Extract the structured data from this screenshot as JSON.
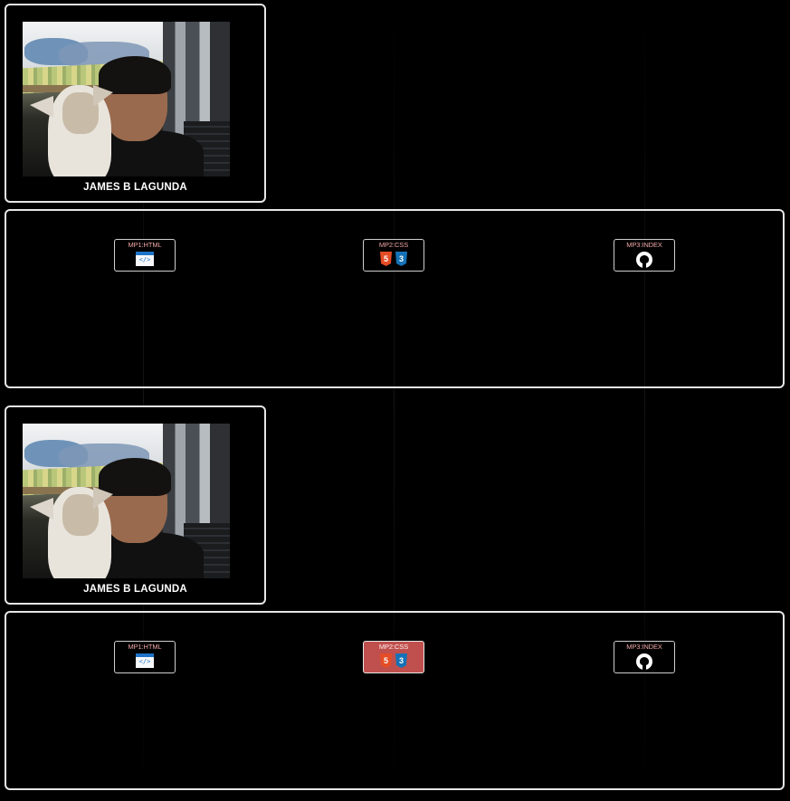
{
  "sections": [
    {
      "profile": {
        "name": "JAMES B LAGUNDA",
        "photo_alt": "photo-of-person-with-dog"
      },
      "links": [
        {
          "label": "MP1:HTML",
          "icon": "html-file-icon",
          "active": false
        },
        {
          "label": "MP2:CSS",
          "icon": "html5-css3-icon",
          "active": false
        },
        {
          "label": "MP3:INDEX",
          "icon": "github-icon",
          "active": false
        }
      ]
    },
    {
      "profile": {
        "name": "JAMES B LAGUNDA",
        "photo_alt": "photo-of-person-with-dog"
      },
      "links": [
        {
          "label": "MP1:HTML",
          "icon": "html-file-icon",
          "active": false
        },
        {
          "label": "MP2:CSS",
          "icon": "html5-css3-icon",
          "active": true
        },
        {
          "label": "MP3:INDEX",
          "icon": "github-icon",
          "active": false
        }
      ]
    }
  ],
  "colors": {
    "background": "#000000",
    "border": "#e6e6e6",
    "active_button": "#c0504d",
    "link_text": "#f0a6a6"
  }
}
